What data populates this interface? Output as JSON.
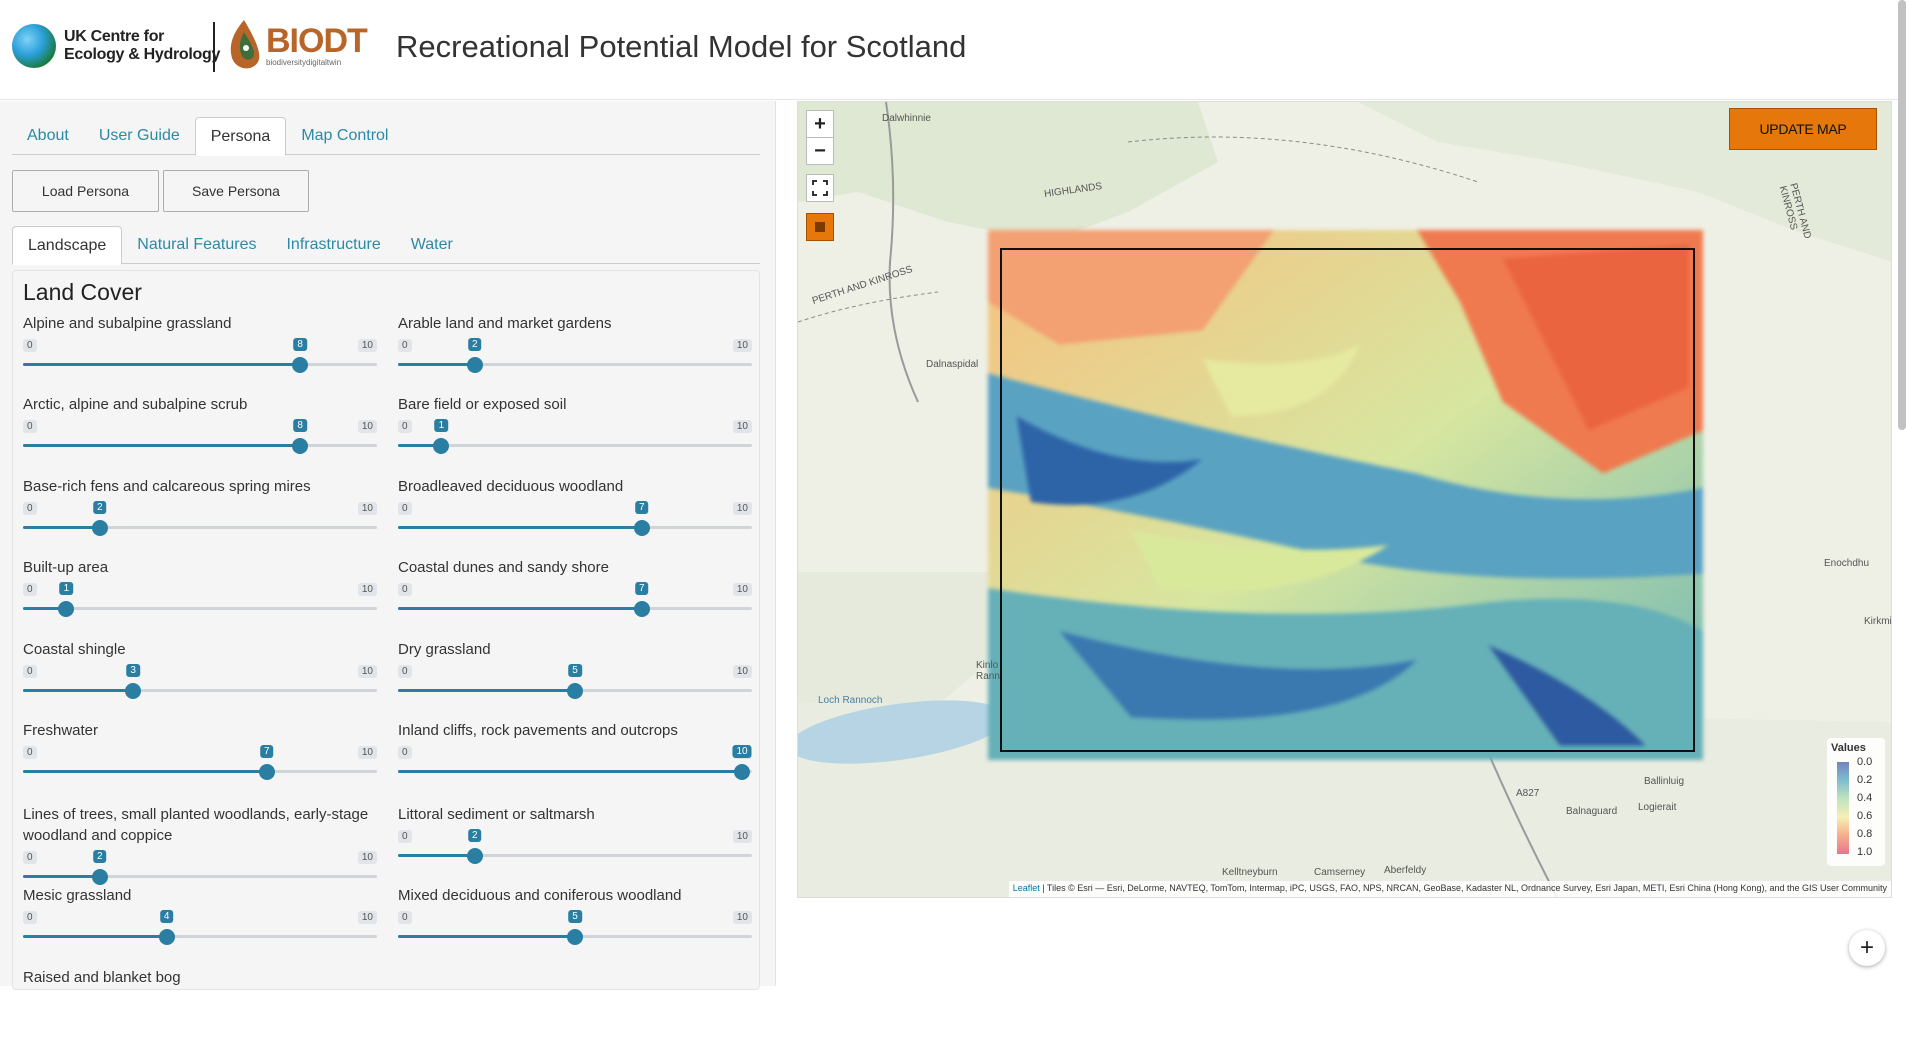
{
  "header": {
    "ukceh_line1": "UK Centre for",
    "ukceh_line2": "Ecology & Hydrology",
    "biodt_name": "BIODT",
    "biodt_sub": "biodiversitydigitaltwin",
    "title": "Recreational Potential Model for Scotland"
  },
  "tabs": [
    {
      "label": "About"
    },
    {
      "label": "User Guide"
    },
    {
      "label": "Persona"
    },
    {
      "label": "Map Control"
    }
  ],
  "buttons": {
    "load": "Load Persona",
    "save": "Save Persona"
  },
  "subtabs": [
    {
      "label": "Landscape"
    },
    {
      "label": "Natural Features"
    },
    {
      "label": "Infrastructure"
    },
    {
      "label": "Water"
    }
  ],
  "section_title": "Land Cover",
  "sliders": [
    {
      "label": "Alpine and subalpine grassland",
      "value": 8,
      "min": 0,
      "max": 10
    },
    {
      "label": "Arable land and market gardens",
      "value": 2,
      "min": 0,
      "max": 10
    },
    {
      "label": "Arctic, alpine and subalpine scrub",
      "value": 8,
      "min": 0,
      "max": 10
    },
    {
      "label": "Bare field or exposed soil",
      "value": 1,
      "min": 0,
      "max": 10
    },
    {
      "label": "Base-rich fens and calcareous spring mires",
      "value": 2,
      "min": 0,
      "max": 10
    },
    {
      "label": "Broadleaved deciduous woodland",
      "value": 7,
      "min": 0,
      "max": 10
    },
    {
      "label": "Built-up area",
      "value": 1,
      "min": 0,
      "max": 10
    },
    {
      "label": "Coastal dunes and sandy shore",
      "value": 7,
      "min": 0,
      "max": 10
    },
    {
      "label": "Coastal shingle",
      "value": 3,
      "min": 0,
      "max": 10
    },
    {
      "label": "Dry grassland",
      "value": 5,
      "min": 0,
      "max": 10
    },
    {
      "label": "Freshwater",
      "value": 7,
      "min": 0,
      "max": 10
    },
    {
      "label": "Inland cliffs, rock pavements and outcrops",
      "value": 10,
      "min": 0,
      "max": 10
    },
    {
      "label": "Lines of trees, small planted woodlands, early-stage woodland and coppice",
      "value": 2,
      "min": 0,
      "max": 10
    },
    {
      "label": "Littoral sediment or saltmarsh",
      "value": 2,
      "min": 0,
      "max": 10
    },
    {
      "label": "Mesic grassland",
      "value": 4,
      "min": 0,
      "max": 10
    },
    {
      "label": "Mixed deciduous and coniferous woodland",
      "value": 5,
      "min": 0,
      "max": 10
    },
    {
      "label": "Raised and blanket bog",
      "value": null,
      "min": 0,
      "max": 10
    }
  ],
  "map": {
    "zoom_in": "+",
    "zoom_out": "−",
    "update_button": "UPDATE MAP",
    "places": [
      "Dalwhinnie",
      "HIGHLANDS",
      "PERTH AND KINROSS",
      "Dalnaspidal",
      "PERTH AND KINROSS",
      "Enochdhu",
      "Kirkmic",
      "Kinlo Rann",
      "Loch Rannoch",
      "Ballinluig",
      "Balnaguard",
      "Logierait",
      "Kelltneyburn",
      "Camserney",
      "Aberfeldy",
      "A827"
    ],
    "legend_title": "Values",
    "legend_ticks": [
      "0.0",
      "0.2",
      "0.4",
      "0.6",
      "0.8",
      "1.0"
    ],
    "attribution_link": "Leaflet",
    "attribution_text": " | Tiles © Esri — Esri, DeLorme, NAVTEQ, TomTom, Intermap, iPC, USGS, FAO, NPS, NRCAN, GeoBase, Kadaster NL, Ordnance Survey, Esri Japan, METI, Esri China (Hong Kong), and the GIS User Community"
  },
  "fab": "+"
}
